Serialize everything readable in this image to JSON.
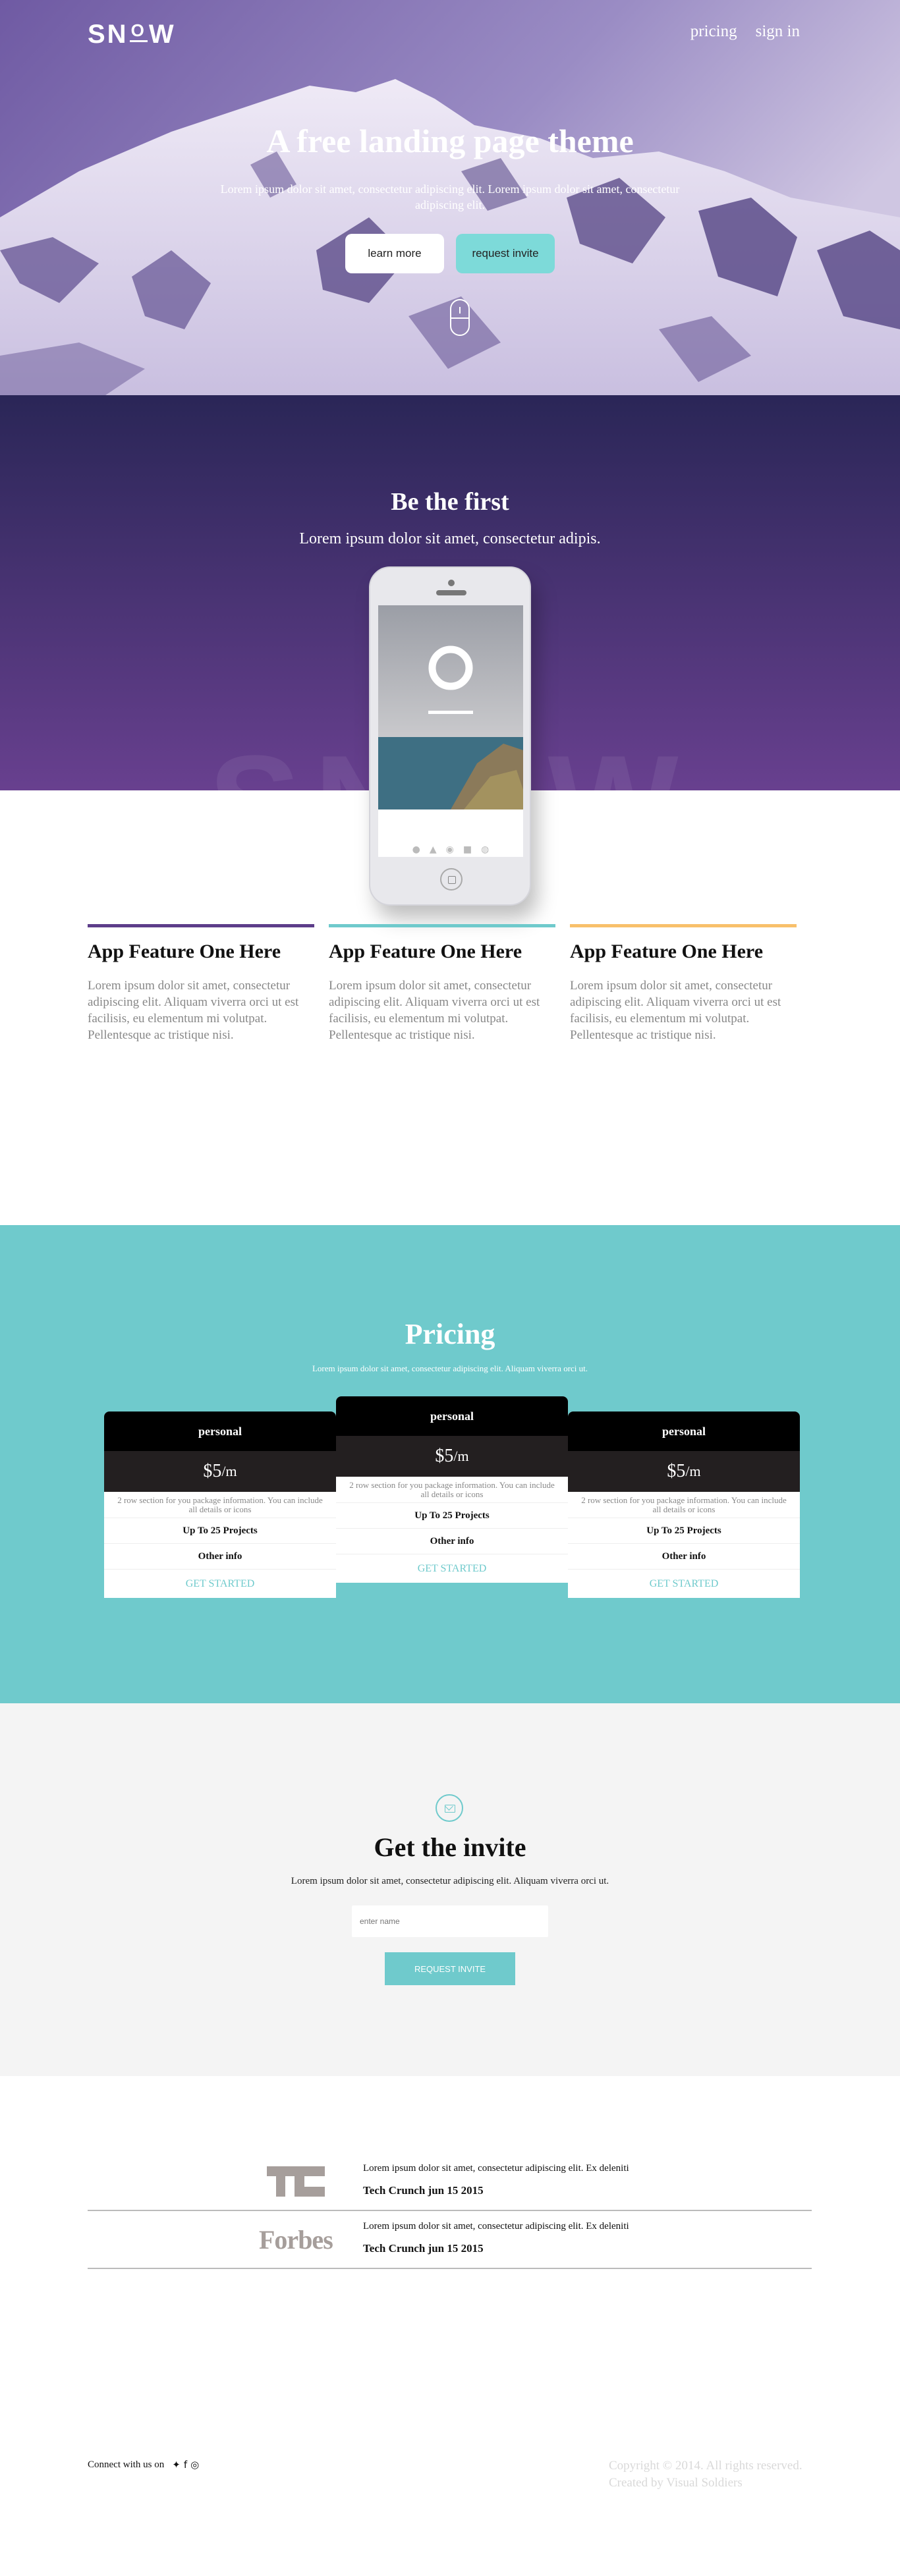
{
  "nav": {
    "logo": "SNOW",
    "links": [
      "pricing",
      "sign in"
    ]
  },
  "hero": {
    "title": "A free landing page theme",
    "subtitle": "Lorem ipsum dolor sit amet, consectetur adipiscing elit. Lorem ipsum dolor sit amet, consectetur adipiscing elit.",
    "learn_more": "learn more",
    "request_invite": "request invite"
  },
  "first": {
    "title": "Be the first",
    "subtitle": "Lorem ipsum dolor sit amet, consectetur adipis.",
    "watermark": "SNOW"
  },
  "features": [
    {
      "title": "App Feature One Here",
      "text": "Lorem ipsum dolor sit amet, consectetur adipiscing elit. Aliquam viverra orci ut est facilisis, eu elementum mi volutpat. Pellentesque ac tristique nisi.",
      "color": "#5d3d8a"
    },
    {
      "title": "App Feature One Here",
      "text": "Lorem ipsum dolor sit amet, consectetur adipiscing elit. Aliquam viverra orci ut est facilisis, eu elementum mi volutpat. Pellentesque ac tristique nisi.",
      "color": "#6fcacc"
    },
    {
      "title": "App Feature One Here",
      "text": "Lorem ipsum dolor sit amet, consectetur adipiscing elit. Aliquam viverra orci ut est facilisis, eu elementum mi volutpat. Pellentesque ac tristique nisi.",
      "color": "#f8c06b"
    }
  ],
  "pricing": {
    "title": "Pricing",
    "subtitle": "Lorem ipsum dolor sit amet, consectetur adipiscing elit. Aliquam viverra orci ut.",
    "plans": [
      {
        "name": "personal",
        "price": "$5",
        "period": "/m",
        "description": "2 row section for you package information. You can include all details or icons",
        "feature1": "Up To 25 Projects",
        "feature2": "Other info",
        "cta": "GET STARTED"
      },
      {
        "name": "personal",
        "price": "$5",
        "period": "/m",
        "description": "2 row section for you package information. You can include all details or icons",
        "feature1": "Up To 25 Projects",
        "feature2": "Other info",
        "cta": "GET STARTED"
      },
      {
        "name": "personal",
        "price": "$5",
        "period": "/m",
        "description": "2 row section for you package information. You can include all details or icons",
        "feature1": "Up To 25 Projects",
        "feature2": "Other info",
        "cta": "GET STARTED"
      }
    ]
  },
  "invite": {
    "title": "Get the invite",
    "subtitle": "Lorem ipsum dolor sit amet, consectetur adipiscing elit. Aliquam viverra orci ut.",
    "placeholder": "enter name",
    "button": "REQUEST INVITE"
  },
  "press": [
    {
      "logo": "TC",
      "text": "Lorem ipsum dolor sit amet, consectetur adipiscing elit. Ex deleniti",
      "date": "Tech Crunch jun 15 2015"
    },
    {
      "logo": "Forbes",
      "text": "Lorem ipsum dolor sit amet, consectetur adipiscing elit. Ex deleniti",
      "date": "Tech Crunch jun 15 2015"
    }
  ],
  "footer": {
    "connect": "Connect with us on",
    "copyright": "Copyright © 2014. All rights reserved.",
    "credit": "Created by Visual Soldiers"
  },
  "colors": {
    "accent": "#6fcacc",
    "purple_top": "#2a2657",
    "purple_bottom": "#68408f"
  }
}
